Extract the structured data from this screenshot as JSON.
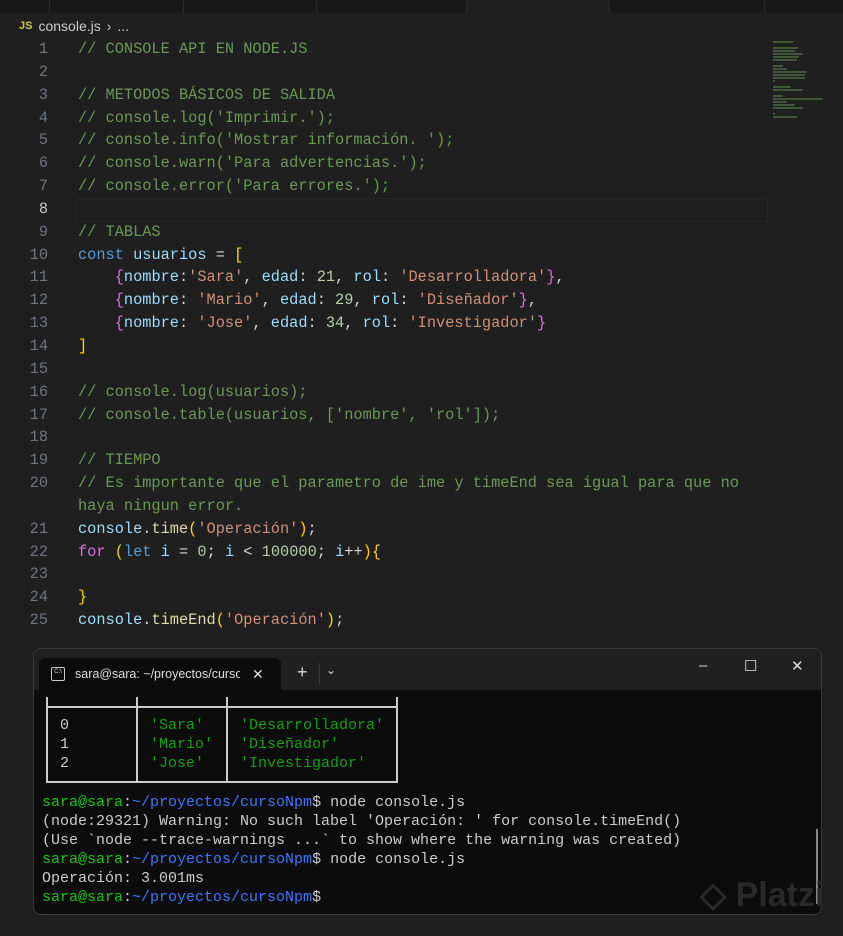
{
  "breadcrumb": {
    "file_icon": "JS",
    "file": "console.js",
    "separator": "›",
    "rest": "..."
  },
  "editor": {
    "lines": [
      {
        "n": "1",
        "t": [
          [
            "// CONSOLE API EN NODE.JS",
            "c"
          ]
        ]
      },
      {
        "n": "2",
        "t": []
      },
      {
        "n": "3",
        "t": [
          [
            "// METODOS BÁSICOS DE SALIDA",
            "c"
          ]
        ]
      },
      {
        "n": "4",
        "t": [
          [
            "// console.log('Imprimir.');",
            "c"
          ]
        ]
      },
      {
        "n": "5",
        "t": [
          [
            "// console.info('Mostrar información. ');",
            "c"
          ]
        ]
      },
      {
        "n": "6",
        "t": [
          [
            "// console.warn('Para advertencias.');",
            "c"
          ]
        ]
      },
      {
        "n": "7",
        "t": [
          [
            "// console.error('Para errores.');",
            "c"
          ]
        ]
      },
      {
        "n": "8",
        "t": [],
        "current": true
      },
      {
        "n": "9",
        "t": [
          [
            "// TABLAS",
            "c"
          ]
        ]
      },
      {
        "n": "10",
        "t": [
          [
            "const",
            "k"
          ],
          [
            " ",
            "p"
          ],
          [
            "usuarios",
            "v"
          ],
          [
            " = ",
            "p"
          ],
          [
            "[",
            "b1"
          ]
        ]
      },
      {
        "n": "11",
        "t": [
          [
            "    ",
            "p"
          ],
          [
            "{",
            "b2"
          ],
          [
            "nombre",
            "v"
          ],
          [
            ":",
            "p"
          ],
          [
            "'Sara'",
            "s"
          ],
          [
            ", ",
            "p"
          ],
          [
            "edad",
            "v"
          ],
          [
            ": ",
            "p"
          ],
          [
            "21",
            "n"
          ],
          [
            ", ",
            "p"
          ],
          [
            "rol",
            "v"
          ],
          [
            ": ",
            "p"
          ],
          [
            "'Desarrolladora'",
            "s"
          ],
          [
            "}",
            "b2"
          ],
          [
            ",",
            "p"
          ]
        ]
      },
      {
        "n": "12",
        "t": [
          [
            "    ",
            "p"
          ],
          [
            "{",
            "b2"
          ],
          [
            "nombre",
            "v"
          ],
          [
            ": ",
            "p"
          ],
          [
            "'Mario'",
            "s"
          ],
          [
            ", ",
            "p"
          ],
          [
            "edad",
            "v"
          ],
          [
            ": ",
            "p"
          ],
          [
            "29",
            "n"
          ],
          [
            ", ",
            "p"
          ],
          [
            "rol",
            "v"
          ],
          [
            ": ",
            "p"
          ],
          [
            "'Diseñador'",
            "s"
          ],
          [
            "}",
            "b2"
          ],
          [
            ",",
            "p"
          ]
        ]
      },
      {
        "n": "13",
        "t": [
          [
            "    ",
            "p"
          ],
          [
            "{",
            "b2"
          ],
          [
            "nombre",
            "v"
          ],
          [
            ": ",
            "p"
          ],
          [
            "'Jose'",
            "s"
          ],
          [
            ", ",
            "p"
          ],
          [
            "edad",
            "v"
          ],
          [
            ": ",
            "p"
          ],
          [
            "34",
            "n"
          ],
          [
            ", ",
            "p"
          ],
          [
            "rol",
            "v"
          ],
          [
            ": ",
            "p"
          ],
          [
            "'Investigador'",
            "s"
          ],
          [
            "}",
            "b2"
          ]
        ]
      },
      {
        "n": "14",
        "t": [
          [
            "]",
            "b1"
          ]
        ]
      },
      {
        "n": "15",
        "t": []
      },
      {
        "n": "16",
        "t": [
          [
            "// console.log(usuarios);",
            "c"
          ]
        ]
      },
      {
        "n": "17",
        "t": [
          [
            "// console.table(usuarios, ['nombre', 'rol']);",
            "c"
          ]
        ]
      },
      {
        "n": "18",
        "t": []
      },
      {
        "n": "19",
        "t": [
          [
            "// TIEMPO",
            "c"
          ]
        ]
      },
      {
        "n": "20",
        "t": [
          [
            "// Es importante que el parametro de ime y timeEnd sea igual para que no",
            "c"
          ]
        ]
      },
      {
        "n": "",
        "t": [
          [
            "haya ningun error.",
            "c"
          ]
        ]
      },
      {
        "n": "21",
        "t": [
          [
            "console",
            "v"
          ],
          [
            ".",
            "p"
          ],
          [
            "time",
            "f"
          ],
          [
            "(",
            "b1"
          ],
          [
            "'Operación'",
            "s"
          ],
          [
            ")",
            "b1"
          ],
          [
            ";",
            "p"
          ]
        ]
      },
      {
        "n": "22",
        "t": [
          [
            "for",
            "b2"
          ],
          [
            " ",
            "p"
          ],
          [
            "(",
            "b1"
          ],
          [
            "let",
            "k"
          ],
          [
            " ",
            "p"
          ],
          [
            "i",
            "v"
          ],
          [
            " = ",
            "p"
          ],
          [
            "0",
            "n"
          ],
          [
            "; ",
            "p"
          ],
          [
            "i",
            "v"
          ],
          [
            " < ",
            "p"
          ],
          [
            "100000",
            "n"
          ],
          [
            "; ",
            "p"
          ],
          [
            "i",
            "v"
          ],
          [
            "++",
            "p"
          ],
          [
            ")",
            "b1"
          ],
          [
            "{",
            "b1"
          ]
        ]
      },
      {
        "n": "23",
        "t": []
      },
      {
        "n": "24",
        "t": [
          [
            "}",
            "b1"
          ]
        ]
      },
      {
        "n": "25",
        "t": [
          [
            "console",
            "v"
          ],
          [
            ".",
            "p"
          ],
          [
            "timeEnd",
            "f"
          ],
          [
            "(",
            "b1"
          ],
          [
            "'Operación'",
            "s"
          ],
          [
            ")",
            "b1"
          ],
          [
            ";",
            "p"
          ]
        ]
      }
    ]
  },
  "terminal": {
    "tab_title": "sara@sara: ~/proyectos/cursoNpm",
    "tab_icon": "C:\\",
    "close": "✕",
    "new_tab": "+",
    "dropdown": "⌄",
    "minimize": "–",
    "maximize": "☐",
    "close_window": "✕",
    "table": {
      "index": [
        "0",
        "1",
        "2"
      ],
      "nombre": [
        "'Sara'",
        "'Mario'",
        "'Jose'"
      ],
      "rol": [
        "'Desarrolladora'",
        "'Diseñador'",
        "'Investigador'"
      ]
    },
    "lines": [
      {
        "user": "sara@sara",
        "colon": ":",
        "path": "~/proyectos/cursoNpm",
        "cmd": "$ node console.js"
      },
      {
        "text": "(node:29321) Warning: No such label 'Operación: ' for console.timeEnd()"
      },
      {
        "text": "(Use `node --trace-warnings ...` to show where the warning was created)"
      },
      {
        "user": "sara@sara",
        "colon": ":",
        "path": "~/proyectos/cursoNpm",
        "cmd": "$ node console.js"
      },
      {
        "text": "Operación: 3.001ms"
      },
      {
        "user": "sara@sara",
        "colon": ":",
        "path": "~/proyectos/cursoNpm",
        "cmd": "$"
      }
    ]
  },
  "watermark": "Platzi",
  "colors": {
    "comment": "#6A9955",
    "keyword": "#569CD6",
    "string": "#CE9178",
    "number": "#B5CEA8",
    "prompt_user": "#16C60C",
    "prompt_path": "#3B78FF",
    "table_string": "#13A10E"
  }
}
